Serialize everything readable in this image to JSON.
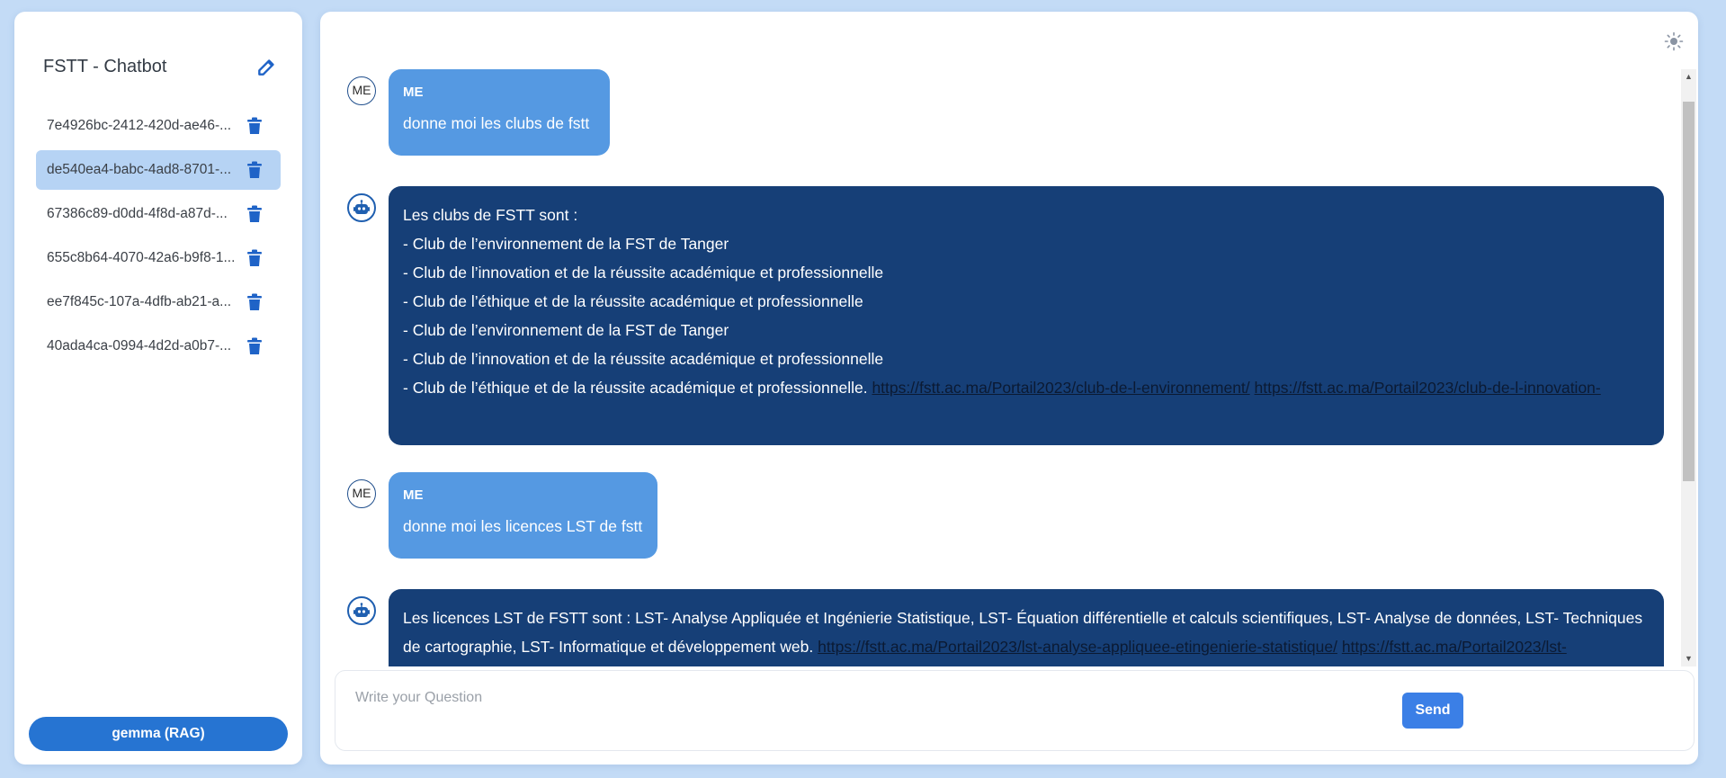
{
  "sidebar": {
    "title": "FSTT - Chatbot",
    "conversations": [
      {
        "label": "7e4926bc-2412-420d-ae46-..."
      },
      {
        "label": "de540ea4-babc-4ad8-8701-..."
      },
      {
        "label": "67386c89-d0dd-4f8d-a87d-..."
      },
      {
        "label": "655c8b64-4070-42a6-b9f8-1..."
      },
      {
        "label": "ee7f845c-107a-4dfb-ab21-a..."
      },
      {
        "label": "40ada4ca-0994-4d2d-a0b7-..."
      }
    ],
    "active_index": 1,
    "model_button": "gemma (RAG)"
  },
  "messages": [
    {
      "role": "user",
      "avatar": "ME",
      "sender": "ME",
      "text": "donne moi les clubs de fstt"
    },
    {
      "role": "bot",
      "lines": [
        "Les clubs de FSTT sont :",
        "- Club de l’environnement de la FST de Tanger",
        "- Club de l’innovation et de la réussite académique et professionnelle",
        "- Club de l’éthique et de la réussite académique et professionnelle",
        "- Club de l’environnement de la FST de Tanger",
        "- Club de l’innovation et de la réussite académique et professionnelle",
        "- Club de l’éthique et de la réussite académique et professionnelle."
      ],
      "links": [
        "https://fstt.ac.ma/Portail2023/club-de-l-environnement/",
        "https://fstt.ac.ma/Portail2023/club-de-l-innovation-"
      ]
    },
    {
      "role": "user",
      "avatar": "ME",
      "sender": "ME",
      "text": "donne moi les licences LST de fstt"
    },
    {
      "role": "bot",
      "text": "Les licences LST de FSTT sont : LST- Analyse Appliquée et Ingénierie Statistique, LST- Équation différentielle et calculs scientifiques, LST- Analyse de données, LST- Techniques de cartographie, LST- Informatique et développement web.",
      "links": [
        "https://fstt.ac.ma/Portail2023/lst-analyse-appliquee-etingenierie-statistique/",
        "https://fstt.ac.ma/Portail2023/lst-"
      ]
    }
  ],
  "input": {
    "placeholder": "Write your Question",
    "value": ""
  },
  "send_label": "Send",
  "colors": {
    "accent": "#2674d2",
    "user_bubble": "#5599e2",
    "bot_bubble": "#163f77",
    "background": "#c3dbf6"
  }
}
